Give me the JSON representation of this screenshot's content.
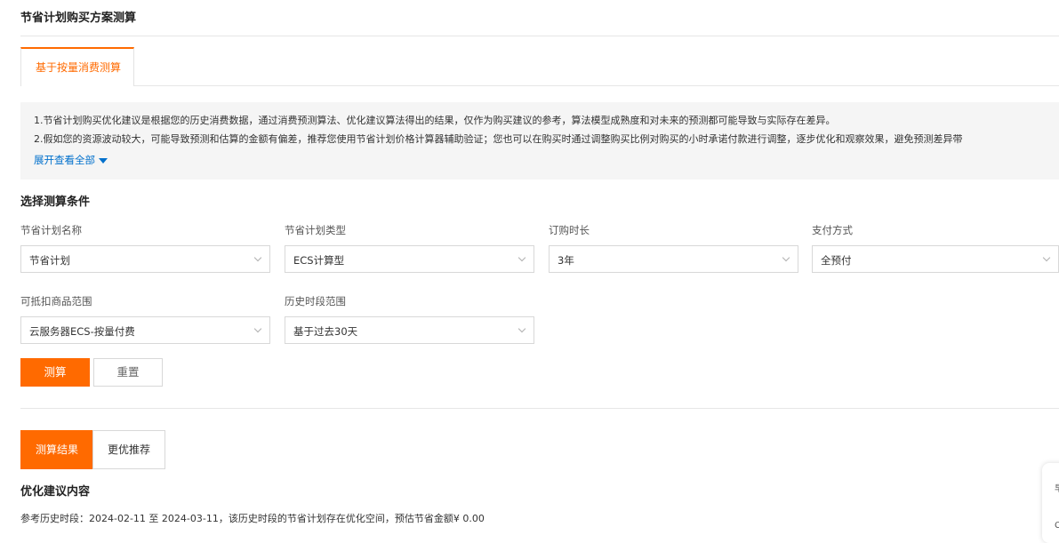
{
  "header": {
    "title": "节省计划购买方案测算"
  },
  "tabs": [
    {
      "label": "基于按量消费测算",
      "active": true
    }
  ],
  "notice": {
    "line1": "1.节省计划购买优化建议是根据您的历史消费数据，通过消费预测算法、优化建议算法得出的结果，仅作为购买建议的参考，算法模型成熟度和对未来的预测都可能导致与实际存在差异。",
    "line2": "2.假如您的资源波动较大，可能导致预测和估算的金额有偏差，推荐您使用节省计划价格计算器辅助验证；您也可以在购买时通过调整购买比例对购买的小时承诺付款进行调整，逐步优化和观察效果，避免预测差异带",
    "expand_label": "展开查看全部"
  },
  "conditions": {
    "section_title": "选择测算条件",
    "fields": [
      {
        "label": "节省计划名称",
        "value": "节省计划"
      },
      {
        "label": "节省计划类型",
        "value": "ECS计算型"
      },
      {
        "label": "订购时长",
        "value": "3年"
      },
      {
        "label": "支付方式",
        "value": "全预付"
      },
      {
        "label": "可抵扣商品范围",
        "value": "云服务器ECS-按量付费"
      },
      {
        "label": "历史时段范围",
        "value": "基于过去30天"
      }
    ],
    "calc_label": "测算",
    "reset_label": "重置"
  },
  "results": {
    "tabs": [
      {
        "label": "测算结果",
        "active": true
      },
      {
        "label": "更优推荐",
        "active": false
      }
    ],
    "section_title": "优化建议内容",
    "reference_text": "参考历史时段：2024-02-11 至 2024-03-11，该历史时段的节省计划存在优化空间，预估节省金额¥ 0.00"
  },
  "float_panel": {
    "glyph1": "早",
    "glyph2": "C"
  },
  "colors": {
    "accent": "#ff6a00",
    "link": "#0070cc",
    "notice_bg": "#f5f5f5"
  }
}
